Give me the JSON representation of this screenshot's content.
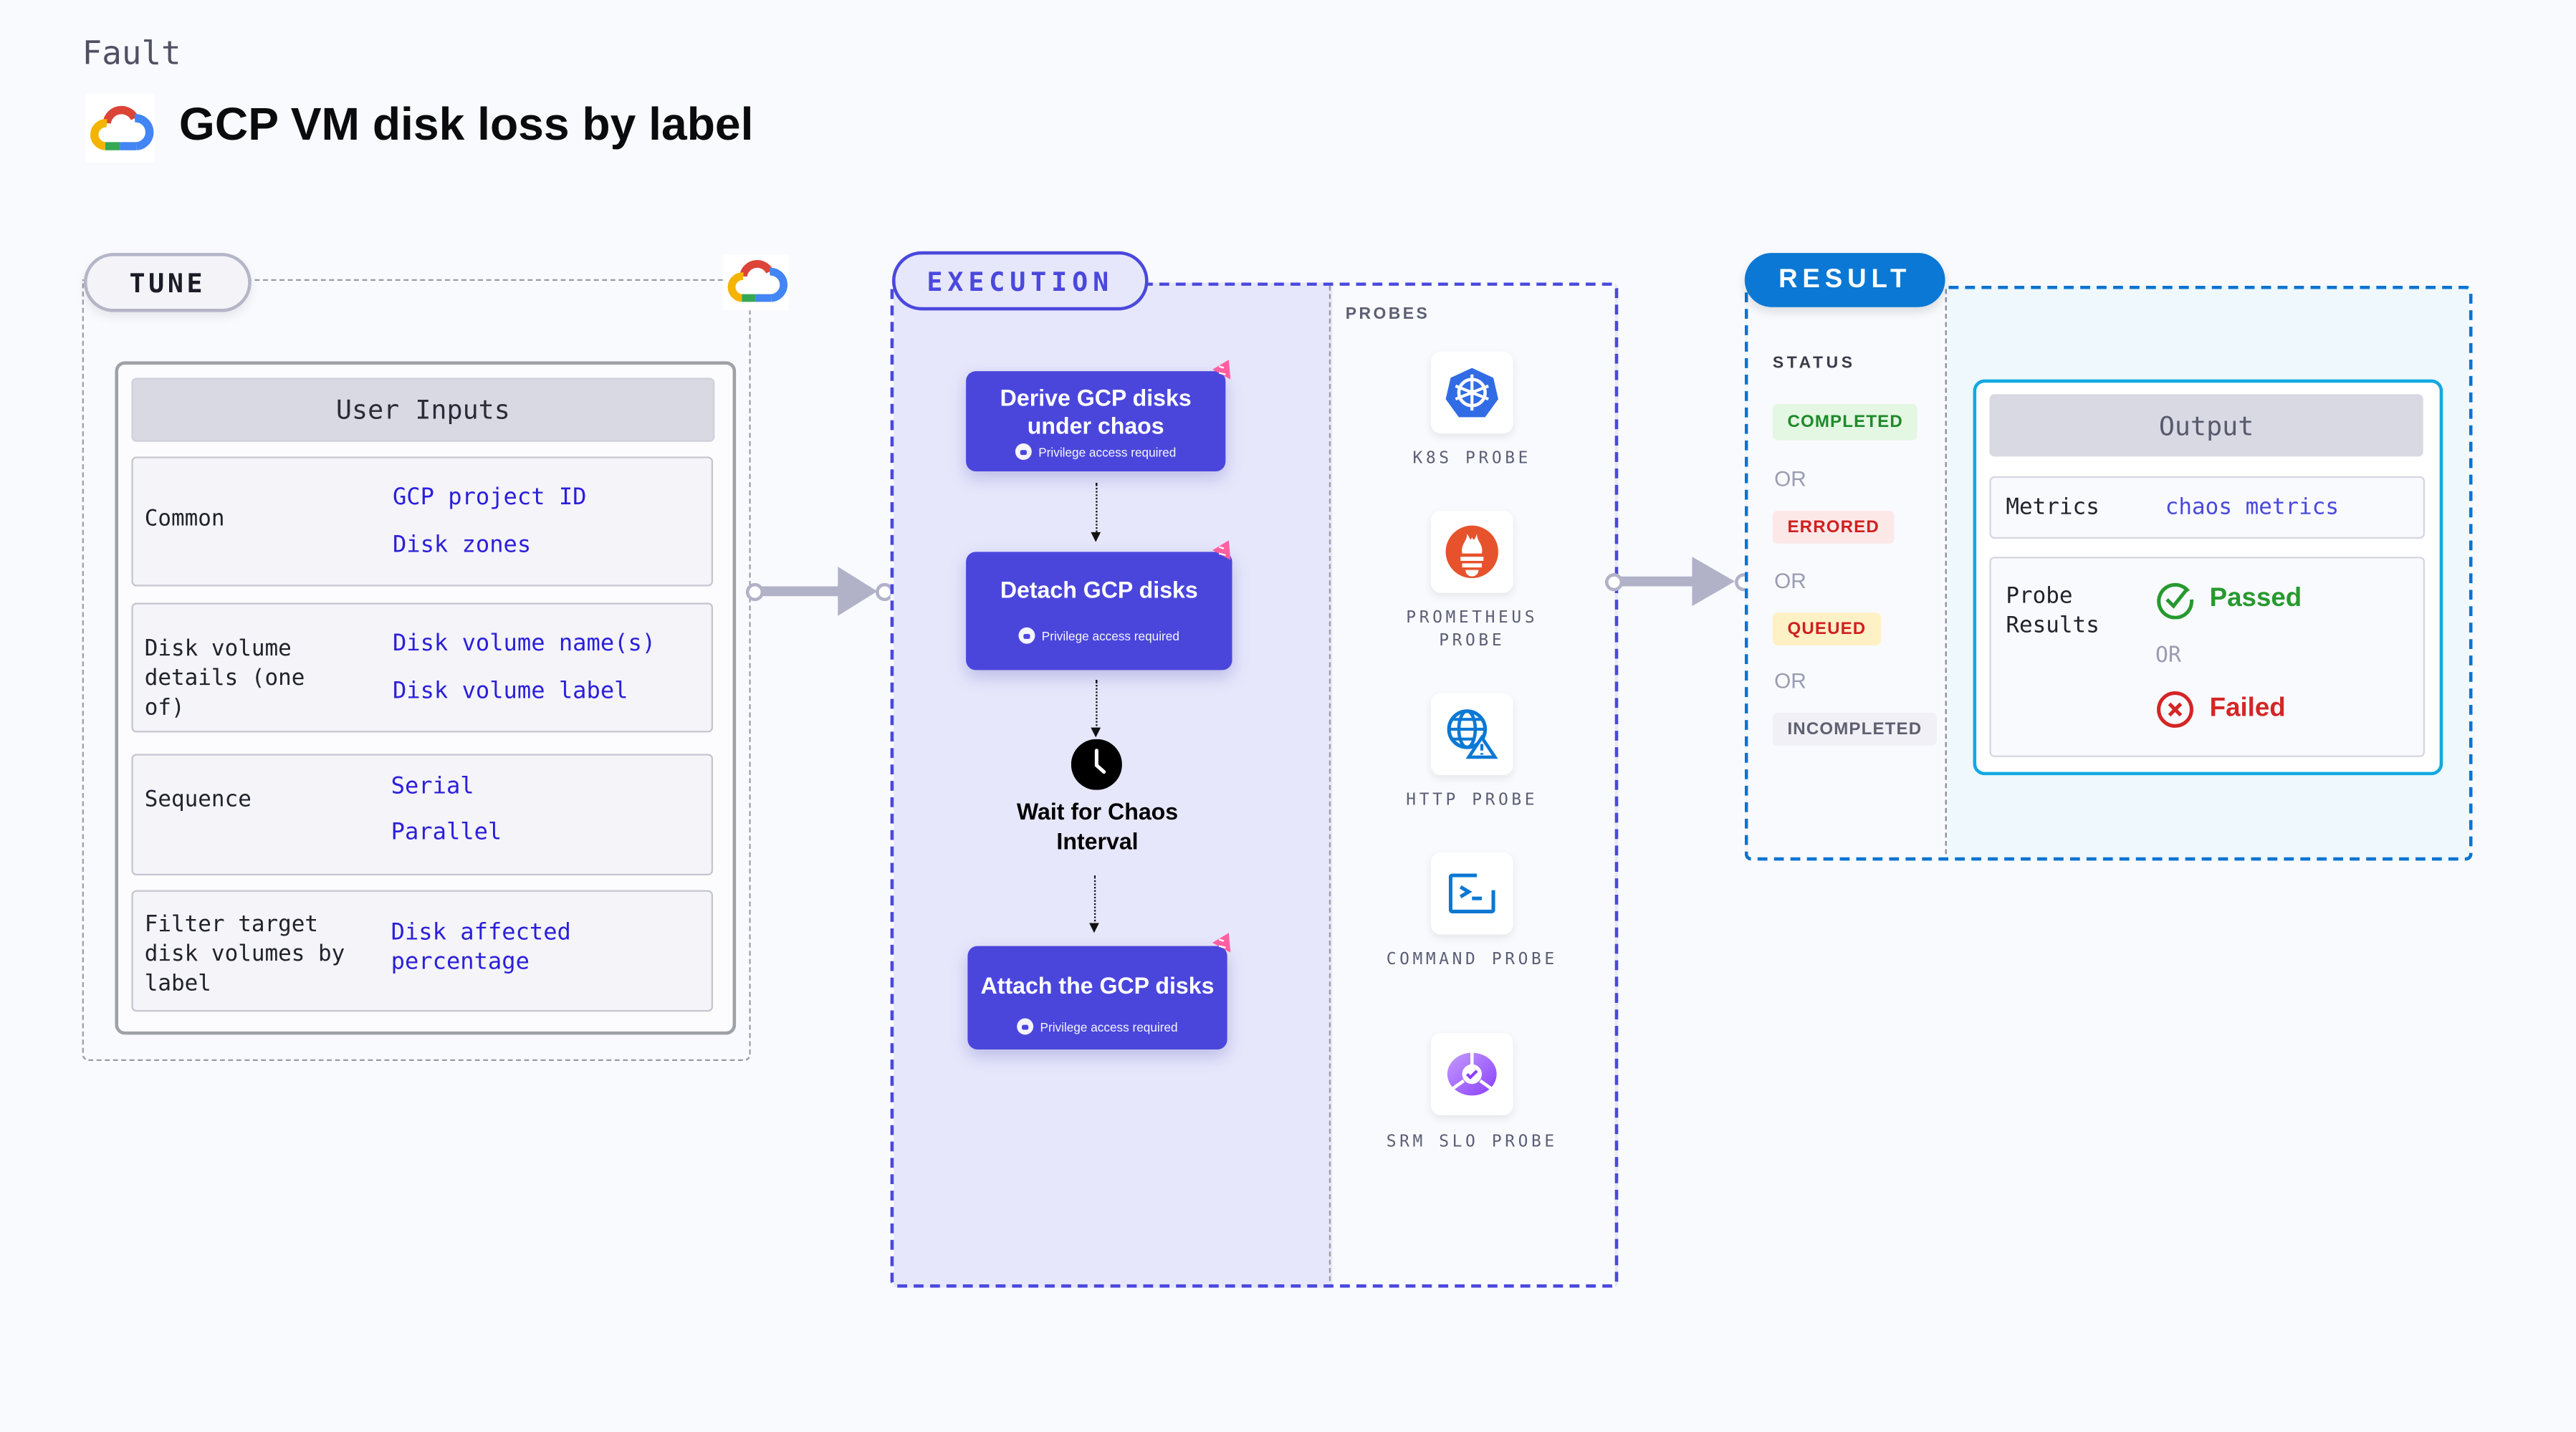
{
  "header": {
    "category": "Fault",
    "title": "GCP VM disk loss by label",
    "logo_icon": "gcp-cloud-icon"
  },
  "tune": {
    "label": "TUNE",
    "card_title": "User Inputs",
    "rows": [
      {
        "label": "Common",
        "values": [
          "GCP project ID",
          "Disk zones"
        ]
      },
      {
        "label": "Disk volume details (one of)",
        "values": [
          "Disk volume name(s)",
          "Disk volume label"
        ]
      },
      {
        "label": "Sequence",
        "values": [
          "Serial",
          "Parallel"
        ]
      },
      {
        "label": "Filter target disk volumes by label",
        "values": [
          "Disk affected percentage"
        ]
      }
    ]
  },
  "execution": {
    "label": "EXECUTION",
    "steps": [
      {
        "title": "Derive GCP disks under chaos",
        "note": "Privilege access required"
      },
      {
        "title": "Detach GCP disks",
        "note": "Privilege access required"
      },
      {
        "title": "Attach the GCP disks",
        "note": "Privilege access required"
      }
    ],
    "wait": {
      "title": "Wait for Chaos Interval",
      "icon": "clock-icon"
    },
    "probes_label": "PROBES",
    "probes": [
      {
        "name": "K8S PROBE",
        "icon": "kubernetes-icon"
      },
      {
        "name": "PROMETHEUS PROBE",
        "icon": "prometheus-icon"
      },
      {
        "name": "HTTP PROBE",
        "icon": "globe-warning-icon"
      },
      {
        "name": "COMMAND PROBE",
        "icon": "terminal-icon"
      },
      {
        "name": "SRM SLO PROBE",
        "icon": "slo-icon"
      }
    ]
  },
  "result": {
    "label": "RESULT",
    "status_label": "STATUS",
    "or_label": "OR",
    "statuses": [
      {
        "text": "COMPLETED",
        "color": "#1e8a2a",
        "bg": "#e3f7e3"
      },
      {
        "text": "ERRORED",
        "color": "#d02020",
        "bg": "#fde8e8"
      },
      {
        "text": "QUEUED",
        "color": "#d02020",
        "bg": "#fff1c6"
      },
      {
        "text": "INCOMPLETED",
        "color": "#5e6070",
        "bg": "#f0f0f6"
      }
    ],
    "output": {
      "title": "Output",
      "metrics_label": "Metrics",
      "metrics_value": "chaos metrics",
      "probe_results_label": "Probe Results",
      "passed": "Passed",
      "failed": "Failed",
      "or_label": "OR"
    }
  },
  "colors": {
    "execution_accent": "#4a48dd",
    "result_accent": "#0a78d4",
    "input_value": "#2b1fd9",
    "passed": "#27992f",
    "failed": "#d42626"
  }
}
